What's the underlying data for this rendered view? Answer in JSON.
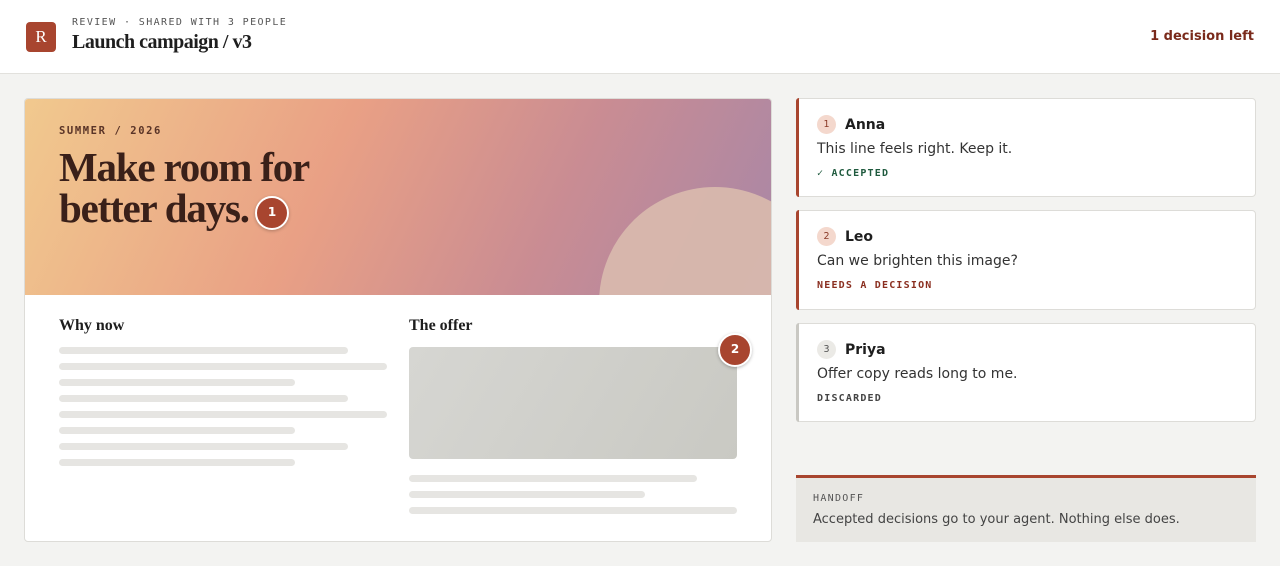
{
  "header": {
    "logo_letter": "R",
    "kicker": "REVIEW · SHARED WITH 3 PEOPLE",
    "title": "Launch campaign / v3",
    "decisions_left": "1 decision left"
  },
  "canvas": {
    "hero_kicker": "SUMMER / 2026",
    "hero_headline": "Make room for better days.",
    "why_title": "Why now",
    "offer_title": "The offer",
    "pins": [
      "1",
      "2"
    ]
  },
  "comments": [
    {
      "num": "1",
      "author": "Anna",
      "text": "This line feels right. Keep it.",
      "status": "✓ ACCEPTED"
    },
    {
      "num": "2",
      "author": "Leo",
      "text": "Can we brighten this image?",
      "status": "NEEDS A DECISION"
    },
    {
      "num": "3",
      "author": "Priya",
      "text": "Offer copy reads long to me.",
      "status": "DISCARDED"
    }
  ],
  "handoff": {
    "kicker": "HANDOFF",
    "text": "Accepted decisions go to your agent. Nothing else does."
  },
  "colors": {
    "accent": "#a8452f",
    "accepted": "#1f5a3e",
    "needs_decision": "#8a2e1f"
  }
}
